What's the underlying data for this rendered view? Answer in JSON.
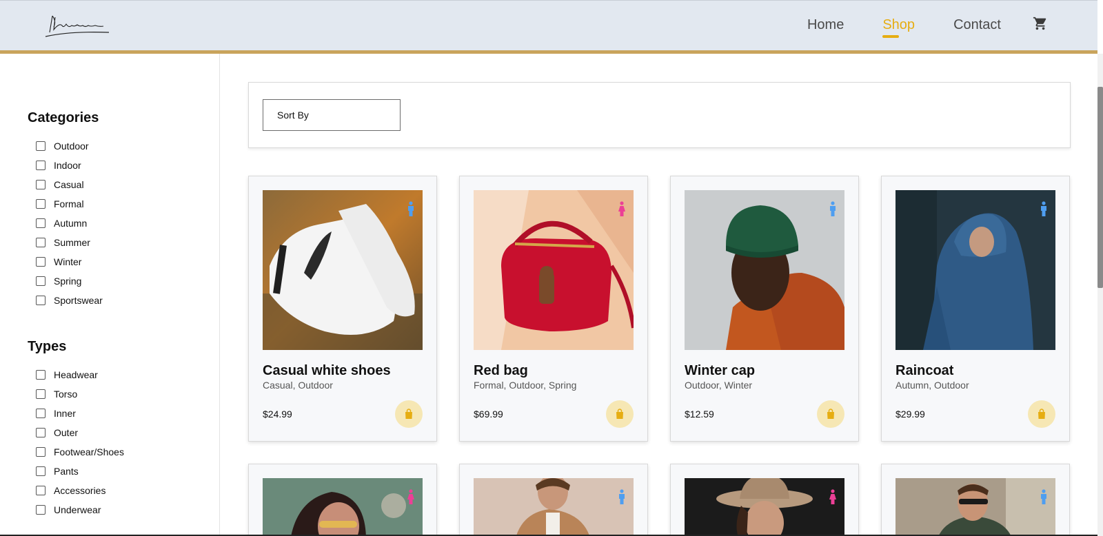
{
  "header": {
    "logo_text": "Hardware",
    "nav": [
      {
        "label": "Home",
        "active": false
      },
      {
        "label": "Shop",
        "active": true
      },
      {
        "label": "Contact",
        "active": false
      }
    ],
    "cart_icon": "cart-icon",
    "accent_color": "#e6ad12",
    "underline_color": "#c9a45c"
  },
  "sidebar": {
    "categories_title": "Categories",
    "categories": [
      "Outdoor",
      "Indoor",
      "Casual",
      "Formal",
      "Autumn",
      "Summer",
      "Winter",
      "Spring",
      "Sportswear"
    ],
    "types_title": "Types",
    "types": [
      "Headwear",
      "Torso",
      "Inner",
      "Outer",
      "Footwear/Shoes",
      "Pants",
      "Accessories",
      "Underwear"
    ]
  },
  "sort": {
    "label": "Sort By"
  },
  "products": [
    {
      "title": "Casual white shoes",
      "tags": "Casual, Outdoor",
      "price": "$24.99",
      "gender": "male"
    },
    {
      "title": "Red bag",
      "tags": "Formal, Outdoor, Spring",
      "price": "$69.99",
      "gender": "female"
    },
    {
      "title": "Winter cap",
      "tags": "Outdoor, Winter",
      "price": "$12.59",
      "gender": "male"
    },
    {
      "title": "Raincoat",
      "tags": "Autumn, Outdoor",
      "price": "$29.99",
      "gender": "male"
    },
    {
      "title": "",
      "tags": "",
      "price": "",
      "gender": "female"
    },
    {
      "title": "",
      "tags": "",
      "price": "",
      "gender": "male"
    },
    {
      "title": "",
      "tags": "",
      "price": "",
      "gender": "female"
    },
    {
      "title": "",
      "tags": "",
      "price": "",
      "gender": "male"
    }
  ],
  "colors": {
    "male": "#4f9ef0",
    "female": "#ec3f96",
    "bag_bg": "#f6e7b4",
    "bag_icon": "#e6ad12"
  }
}
